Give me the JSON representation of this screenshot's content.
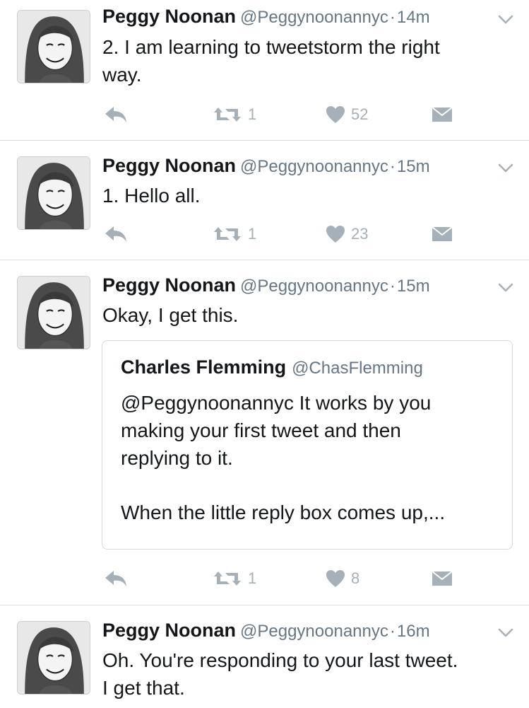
{
  "colors": {
    "icon": "#a5b0b8",
    "name": "#14171a",
    "meta": "#657786",
    "divider": "#dcdfe2"
  },
  "tweets": [
    {
      "name": "Peggy Noonan",
      "handle": "@Peggynoonannyc",
      "dot": "·",
      "time": "14m",
      "text_lines": [
        "2.  I am learning to tweetstorm the right",
        "way."
      ],
      "retweets": "1",
      "likes": "52"
    },
    {
      "name": "Peggy Noonan",
      "handle": "@Peggynoonannyc",
      "dot": "·",
      "time": "15m",
      "text_lines": [
        "1. Hello all."
      ],
      "retweets": "1",
      "likes": "23"
    },
    {
      "name": "Peggy Noonan",
      "handle": "@Peggynoonannyc",
      "dot": "·",
      "time": "15m",
      "text_lines": [
        "Okay, I get this."
      ],
      "quote": {
        "name": "Charles Flemming",
        "handle": "@ChasFlemming",
        "lines": [
          "@Peggynoonannyc It works by you",
          "making your first tweet and then",
          "replying to it."
        ],
        "lines2": [
          "When the little reply box comes up,..."
        ]
      },
      "retweets": "1",
      "likes": "8"
    },
    {
      "name": "Peggy Noonan",
      "handle": "@Peggynoonannyc",
      "dot": "·",
      "time": "16m",
      "text_lines": [
        "Oh. You're responding to your last tweet.",
        "I get that."
      ]
    }
  ]
}
